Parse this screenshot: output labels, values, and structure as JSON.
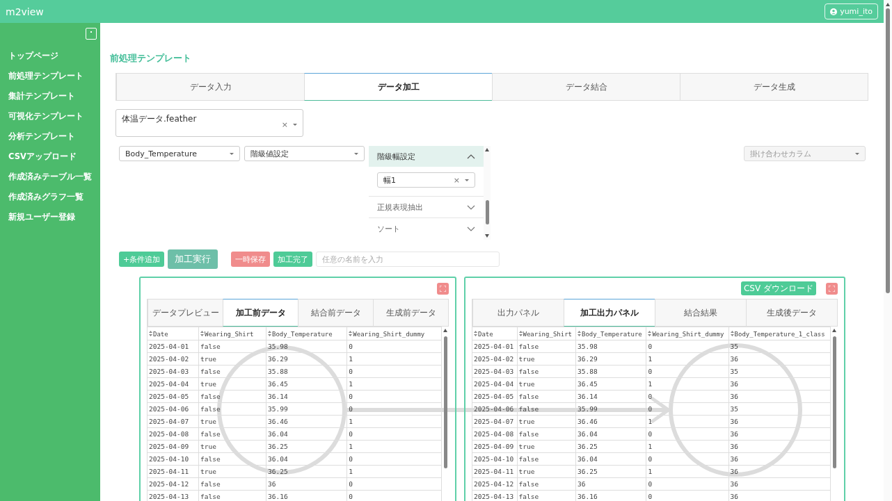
{
  "app": {
    "title": "m2view",
    "user": "yumi_ito"
  },
  "sidebar": {
    "items": [
      "トップページ",
      "前処理テンプレート",
      "集計テンプレート",
      "可視化テンプレート",
      "分析テンプレート",
      "CSVアップロード",
      "作成済みテーブル一覧",
      "作成済みグラフ一覧",
      "新規ユーザー登録"
    ]
  },
  "page_title": "前処理テンプレート",
  "tabs": [
    {
      "label": "データ入力",
      "selected": false
    },
    {
      "label": "データ加工",
      "selected": true
    },
    {
      "label": "データ結合",
      "selected": false
    },
    {
      "label": "データ生成",
      "selected": false
    }
  ],
  "file_select": {
    "value": "体温データ.feather",
    "clear": "×"
  },
  "column_select": {
    "value": "Body_Temperature"
  },
  "operation_select": {
    "value": "階級値設定"
  },
  "accordion": [
    {
      "title": "階級幅設定",
      "expanded": true,
      "select_value": "幅1",
      "select_clear": "×"
    },
    {
      "title": "正規表現抽出",
      "expanded": false
    },
    {
      "title": "ソート",
      "expanded": false
    }
  ],
  "cross_column_select": {
    "placeholder": "掛け合わせカラム",
    "disabled": true
  },
  "buttons": [
    {
      "label": "+条件追加",
      "kind": "add"
    },
    {
      "label": "加工実行",
      "kind": "run"
    },
    {
      "label": "一時保存",
      "kind": "save"
    },
    {
      "label": "加工完了",
      "kind": "done"
    }
  ],
  "name_input": {
    "placeholder": "任意の名前を入力"
  },
  "panels": [
    {
      "tabs": [
        {
          "label": "データプレビュー",
          "selected": false
        },
        {
          "label": "加工前データ",
          "selected": true
        },
        {
          "label": "結合前データ",
          "selected": false
        },
        {
          "label": "生成前データ",
          "selected": false
        }
      ],
      "columns": [
        "Date",
        "Wearing_Shirt",
        "Body_Temperature",
        "Wearing_Shirt_dummy"
      ],
      "rows": [
        [
          "2025-04-01",
          "false",
          "35.98",
          "0"
        ],
        [
          "2025-04-02",
          "true",
          "36.29",
          "1"
        ],
        [
          "2025-04-03",
          "false",
          "35.88",
          "0"
        ],
        [
          "2025-04-04",
          "true",
          "36.45",
          "1"
        ],
        [
          "2025-04-05",
          "false",
          "36.14",
          "0"
        ],
        [
          "2025-04-06",
          "false",
          "35.99",
          "0"
        ],
        [
          "2025-04-07",
          "true",
          "36.46",
          "1"
        ],
        [
          "2025-04-08",
          "false",
          "36.04",
          "0"
        ],
        [
          "2025-04-09",
          "true",
          "36.25",
          "1"
        ],
        [
          "2025-04-10",
          "false",
          "36.04",
          "0"
        ],
        [
          "2025-04-11",
          "true",
          "36.25",
          "1"
        ],
        [
          "2025-04-12",
          "false",
          "36",
          "0"
        ],
        [
          "2025-04-13",
          "false",
          "36.16",
          "0"
        ]
      ]
    },
    {
      "actions": [
        "CSV ダウンロード"
      ],
      "tabs": [
        {
          "label": "出力パネル",
          "selected": false
        },
        {
          "label": "加工出力パネル",
          "selected": true
        },
        {
          "label": "結合結果",
          "selected": false
        },
        {
          "label": "生成後データ",
          "selected": false
        }
      ],
      "columns": [
        "Date",
        "Wearing_Shirt",
        "Body_Temperature",
        "Wearing_Shirt_dummy",
        "Body_Temperature_1_class"
      ],
      "rows": [
        [
          "2025-04-01",
          "false",
          "35.98",
          "0",
          "35"
        ],
        [
          "2025-04-02",
          "true",
          "36.29",
          "1",
          "36"
        ],
        [
          "2025-04-03",
          "false",
          "35.88",
          "0",
          "35"
        ],
        [
          "2025-04-04",
          "true",
          "36.45",
          "1",
          "36"
        ],
        [
          "2025-04-05",
          "false",
          "36.14",
          "0",
          "36"
        ],
        [
          "2025-04-06",
          "false",
          "35.99",
          "0",
          "35"
        ],
        [
          "2025-04-07",
          "true",
          "36.46",
          "1",
          "36"
        ],
        [
          "2025-04-08",
          "false",
          "36.04",
          "0",
          "36"
        ],
        [
          "2025-04-09",
          "true",
          "36.25",
          "1",
          "36"
        ],
        [
          "2025-04-10",
          "false",
          "36.04",
          "0",
          "36"
        ],
        [
          "2025-04-11",
          "true",
          "36.25",
          "1",
          "36"
        ],
        [
          "2025-04-12",
          "false",
          "36",
          "0",
          "36"
        ],
        [
          "2025-04-13",
          "false",
          "36.16",
          "0",
          "36"
        ]
      ]
    }
  ]
}
